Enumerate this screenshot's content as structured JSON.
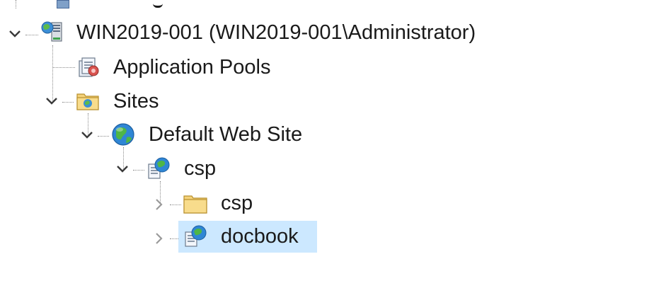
{
  "tree": {
    "server": {
      "label": "WIN2019-001 (WIN2019-001\\Administrator)",
      "icon": "server-icon",
      "expanded": true
    },
    "app_pools": {
      "label": "Application Pools",
      "icon": "app-pools-icon"
    },
    "sites": {
      "label": "Sites",
      "icon": "sites-folder-icon",
      "expanded": true
    },
    "default_site": {
      "label": "Default Web Site",
      "icon": "globe-icon",
      "expanded": true
    },
    "csp_app": {
      "label": "csp",
      "icon": "web-application-icon",
      "expanded": true
    },
    "csp_folder": {
      "label": "csp",
      "icon": "folder-icon",
      "expanded": false
    },
    "docbook": {
      "label": "docbook",
      "icon": "web-application-icon",
      "expanded": false,
      "selected": true
    }
  },
  "colors": {
    "selection": "#cce8ff",
    "chevron_expanded": "#3a3a3a",
    "chevron_collapsed": "#9a9a9a",
    "dotted_line": "#8a8a8a"
  }
}
